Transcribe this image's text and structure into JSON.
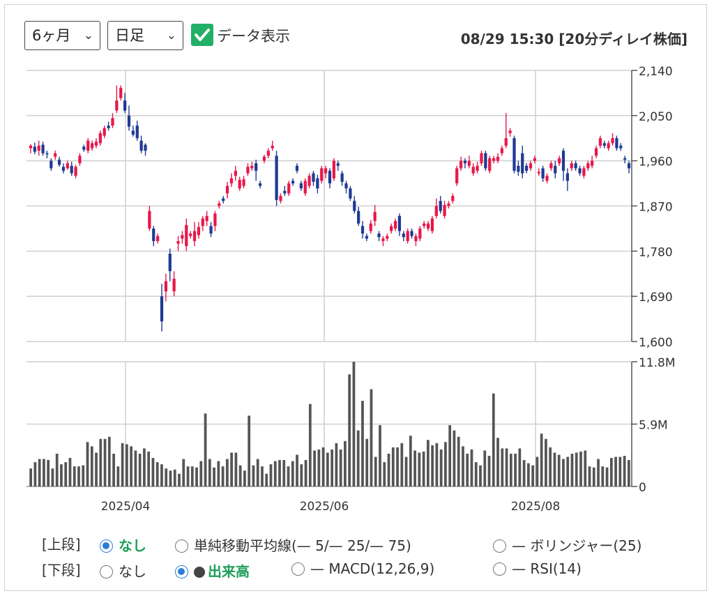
{
  "controls": {
    "period": "6ヶ月",
    "interval": "日足",
    "data_toggle_label": "データ表示",
    "datetime": "08/29 15:30 [20分ディレイ株価]"
  },
  "options": {
    "upper_label": "[上段]",
    "lower_label": "[下段]",
    "upper": [
      {
        "label": "なし",
        "selected": true
      },
      {
        "label": "単純移動平均線(— 5/— 25/— 75)",
        "selected": false
      },
      {
        "label": "— ボリンジャー(25)",
        "selected": false
      }
    ],
    "lower": [
      {
        "label": "なし",
        "selected": false
      },
      {
        "label": "出来高",
        "selected": true
      },
      {
        "label": "— MACD(12,26,9)",
        "selected": false
      },
      {
        "label": "— RSI(14)",
        "selected": false
      }
    ]
  },
  "chart_data": [
    {
      "type": "candlestick",
      "price_ticks": [
        "2,140",
        "2,050",
        "1,960",
        "1,870",
        "1,780",
        "1,690",
        "1,600"
      ],
      "ylim": [
        1600,
        2140
      ],
      "x_ticks": [
        "2025/04",
        "2025/06",
        "2025/08"
      ],
      "up_color": "#e8174a",
      "down_color": "#1f3a93",
      "candles": [
        [
          1985,
          1990,
          1975,
          1993
        ],
        [
          1988,
          1978,
          1973,
          1996
        ],
        [
          1980,
          1990,
          1970,
          2000
        ],
        [
          1992,
          1975,
          1970,
          1998
        ],
        [
          1975,
          1973,
          1965,
          1980
        ],
        [
          1960,
          1945,
          1940,
          1965
        ],
        [
          1968,
          1975,
          1962,
          1980
        ],
        [
          1962,
          1952,
          1948,
          1968
        ],
        [
          1948,
          1940,
          1935,
          1955
        ],
        [
          1945,
          1955,
          1942,
          1960
        ],
        [
          1950,
          1935,
          1930,
          1958
        ],
        [
          1930,
          1948,
          1925,
          1952
        ],
        [
          1955,
          1970,
          1950,
          1975
        ],
        [
          1988,
          1982,
          1978,
          1992
        ],
        [
          1980,
          2000,
          1975,
          2005
        ],
        [
          1985,
          1995,
          1980,
          2000
        ],
        [
          1990,
          1998,
          1985,
          2005
        ],
        [
          1995,
          2015,
          1990,
          2020
        ],
        [
          2010,
          2025,
          2005,
          2030
        ],
        [
          2030,
          2025,
          2020,
          2038
        ],
        [
          2030,
          2045,
          2025,
          2055
        ],
        [
          2060,
          2080,
          2055,
          2110
        ],
        [
          2085,
          2105,
          2080,
          2110
        ],
        [
          2080,
          2060,
          2055,
          2095
        ],
        [
          2050,
          2028,
          2020,
          2070
        ],
        [
          2020,
          2012,
          2008,
          2030
        ],
        [
          2030,
          2005,
          2000,
          2040
        ],
        [
          2000,
          1980,
          1975,
          2010
        ],
        [
          1992,
          1980,
          1970,
          1995
        ],
        [
          1825,
          1860,
          1820,
          1870
        ],
        [
          1825,
          1800,
          1790,
          1830
        ],
        [
          1800,
          1810,
          1795,
          1815
        ],
        [
          1690,
          1640,
          1620,
          1715
        ],
        [
          1700,
          1720,
          1680,
          1735
        ],
        [
          1775,
          1740,
          1720,
          1785
        ],
        [
          1700,
          1725,
          1690,
          1740
        ],
        [
          1795,
          1800,
          1780,
          1810
        ],
        [
          1805,
          1812,
          1795,
          1820
        ],
        [
          1790,
          1832,
          1780,
          1845
        ],
        [
          1810,
          1815,
          1805,
          1820
        ],
        [
          1800,
          1820,
          1790,
          1838
        ],
        [
          1812,
          1828,
          1805,
          1838
        ],
        [
          1830,
          1845,
          1820,
          1850
        ],
        [
          1840,
          1850,
          1830,
          1860
        ],
        [
          1830,
          1815,
          1808,
          1838
        ],
        [
          1830,
          1855,
          1820,
          1860
        ],
        [
          1870,
          1875,
          1865,
          1880
        ],
        [
          1885,
          1880,
          1875,
          1890
        ],
        [
          1895,
          1910,
          1885,
          1918
        ],
        [
          1915,
          1925,
          1908,
          1935
        ],
        [
          1930,
          1940,
          1920,
          1950
        ],
        [
          1905,
          1922,
          1900,
          1928
        ],
        [
          1910,
          1923,
          1905,
          1930
        ],
        [
          1935,
          1948,
          1930,
          1955
        ],
        [
          1945,
          1950,
          1940,
          1958
        ],
        [
          1955,
          1940,
          1920,
          1962
        ],
        [
          1915,
          1910,
          1905,
          1920
        ],
        [
          1960,
          1968,
          1955,
          1972
        ],
        [
          1970,
          1980,
          1965,
          1985
        ],
        [
          1985,
          1990,
          1980,
          2000
        ],
        [
          1970,
          1882,
          1870,
          1980
        ],
        [
          1880,
          1890,
          1875,
          1895
        ],
        [
          1900,
          1895,
          1890,
          1910
        ],
        [
          1895,
          1915,
          1890,
          1920
        ],
        [
          1920,
          1915,
          1910,
          1925
        ],
        [
          1950,
          1940,
          1935,
          1955
        ],
        [
          1915,
          1905,
          1900,
          1920
        ],
        [
          1895,
          1920,
          1890,
          1925
        ],
        [
          1910,
          1930,
          1905,
          1935
        ],
        [
          1935,
          1918,
          1910,
          1940
        ],
        [
          1925,
          1905,
          1895,
          1932
        ],
        [
          1920,
          1945,
          1915,
          1950
        ],
        [
          1935,
          1945,
          1925,
          1950
        ],
        [
          1940,
          1915,
          1905,
          1945
        ],
        [
          1925,
          1960,
          1920,
          1965
        ],
        [
          1955,
          1950,
          1940,
          1960
        ],
        [
          1935,
          1918,
          1910,
          1940
        ],
        [
          1915,
          1905,
          1895,
          1920
        ],
        [
          1905,
          1885,
          1880,
          1910
        ],
        [
          1880,
          1860,
          1855,
          1890
        ],
        [
          1860,
          1835,
          1830,
          1868
        ],
        [
          1830,
          1815,
          1805,
          1840
        ],
        [
          1810,
          1805,
          1800,
          1815
        ],
        [
          1820,
          1835,
          1815,
          1842
        ],
        [
          1840,
          1858,
          1830,
          1872
        ],
        [
          1815,
          1808,
          1800,
          1820
        ],
        [
          1800,
          1805,
          1790,
          1810
        ],
        [
          1805,
          1810,
          1800,
          1815
        ],
        [
          1820,
          1830,
          1815,
          1835
        ],
        [
          1825,
          1840,
          1820,
          1845
        ],
        [
          1850,
          1820,
          1810,
          1855
        ],
        [
          1815,
          1808,
          1800,
          1820
        ],
        [
          1800,
          1820,
          1795,
          1825
        ],
        [
          1820,
          1810,
          1805,
          1825
        ],
        [
          1800,
          1810,
          1790,
          1815
        ],
        [
          1805,
          1825,
          1800,
          1830
        ],
        [
          1830,
          1835,
          1825,
          1840
        ],
        [
          1825,
          1835,
          1820,
          1840
        ],
        [
          1820,
          1845,
          1815,
          1850
        ],
        [
          1850,
          1870,
          1845,
          1885
        ],
        [
          1880,
          1860,
          1855,
          1890
        ],
        [
          1850,
          1872,
          1845,
          1880
        ],
        [
          1870,
          1875,
          1865,
          1880
        ],
        [
          1880,
          1890,
          1875,
          1895
        ],
        [
          1915,
          1945,
          1910,
          1950
        ],
        [
          1945,
          1960,
          1940,
          1968
        ],
        [
          1960,
          1955,
          1945,
          1965
        ],
        [
          1950,
          1960,
          1945,
          1970
        ],
        [
          1935,
          1948,
          1930,
          1955
        ],
        [
          1940,
          1950,
          1935,
          1958
        ],
        [
          1955,
          1975,
          1950,
          1980
        ],
        [
          1975,
          1945,
          1940,
          1980
        ],
        [
          1940,
          1965,
          1935,
          1970
        ],
        [
          1960,
          1965,
          1955,
          1970
        ],
        [
          1960,
          1968,
          1955,
          1975
        ],
        [
          1975,
          1985,
          1970,
          1990
        ],
        [
          1990,
          2005,
          1985,
          2055
        ],
        [
          2015,
          2020,
          2008,
          2025
        ],
        [
          2005,
          1940,
          1935,
          2010
        ],
        [
          1950,
          1938,
          1930,
          1960
        ],
        [
          1975,
          1935,
          1925,
          1990
        ],
        [
          1950,
          1940,
          1935,
          1955
        ],
        [
          1945,
          1955,
          1940,
          1960
        ],
        [
          1960,
          1965,
          1955,
          1970
        ],
        [
          1935,
          1938,
          1930,
          1945
        ],
        [
          1945,
          1925,
          1918,
          1950
        ],
        [
          1920,
          1930,
          1915,
          1935
        ],
        [
          1945,
          1955,
          1940,
          1960
        ],
        [
          1950,
          1935,
          1925,
          1960
        ],
        [
          1955,
          1965,
          1950,
          1970
        ],
        [
          1980,
          1940,
          1920,
          1985
        ],
        [
          1935,
          1920,
          1900,
          1945
        ],
        [
          1945,
          1955,
          1940,
          1960
        ],
        [
          1955,
          1945,
          1940,
          1960
        ],
        [
          1945,
          1935,
          1930,
          1950
        ],
        [
          1930,
          1945,
          1925,
          1950
        ],
        [
          1945,
          1955,
          1940,
          1960
        ],
        [
          1950,
          1960,
          1945,
          1970
        ],
        [
          1970,
          1985,
          1965,
          1990
        ],
        [
          1990,
          2005,
          1985,
          2010
        ],
        [
          1995,
          1990,
          1985,
          2000
        ],
        [
          1985,
          1995,
          1980,
          2000
        ],
        [
          1995,
          2005,
          1990,
          2015
        ],
        [
          2005,
          1985,
          1980,
          2010
        ],
        [
          1990,
          1985,
          1980,
          1995
        ],
        [
          1965,
          1962,
          1955,
          1970
        ],
        [
          1955,
          1945,
          1935,
          1960
        ]
      ]
    },
    {
      "type": "bar",
      "name": "出来高",
      "ticks": [
        "11.8M",
        "5.9M",
        "0"
      ],
      "ylim": [
        0,
        11.8
      ],
      "unit": "M",
      "color": "#555555",
      "values": [
        1.7,
        2.3,
        2.6,
        2.6,
        2.5,
        1.7,
        3.1,
        2.1,
        2.3,
        2.7,
        1.9,
        1.9,
        2.0,
        4.2,
        3.8,
        3.2,
        4.5,
        4.5,
        4.7,
        3.1,
        1.9,
        4.1,
        4.0,
        3.8,
        3.4,
        3.1,
        3.6,
        3.3,
        2.7,
        2.3,
        2.1,
        1.7,
        1.5,
        1.6,
        1.2,
        2.6,
        1.9,
        1.9,
        1.8,
        2.4,
        6.9,
        2.6,
        1.8,
        2.4,
        1.9,
        2.6,
        3.2,
        3.2,
        2.0,
        1.5,
        6.7,
        2.0,
        2.6,
        1.9,
        1.2,
        2.1,
        2.4,
        2.5,
        2.5,
        1.9,
        2.4,
        3.0,
        2.1,
        2.5,
        7.8,
        3.4,
        3.5,
        3.7,
        3.2,
        3.5,
        4.1,
        3.5,
        4.3,
        10.6,
        11.8,
        5.3,
        8.1,
        4.5,
        9.2,
        2.8,
        5.8,
        2.3,
        3.1,
        3.7,
        3.7,
        4.1,
        2.8,
        4.8,
        3.4,
        3.2,
        3.3,
        4.4,
        3.9,
        4.1,
        3.5,
        4.2,
        5.8,
        5.3,
        4.7,
        3.8,
        3.1,
        3.5,
        2.3,
        2.0,
        3.4,
        2.9,
        8.8,
        4.6,
        3.6,
        3.6,
        3.1,
        3.1,
        3.6,
        2.5,
        2.2,
        2.0,
        2.8,
        5.0,
        4.5,
        3.7,
        3.2,
        3.0,
        2.6,
        2.8,
        3.1,
        3.2,
        3.3,
        3.4,
        1.9,
        1.8,
        2.6,
        1.9,
        1.8,
        2.7,
        2.8,
        2.8,
        2.9,
        2.5
      ]
    }
  ]
}
